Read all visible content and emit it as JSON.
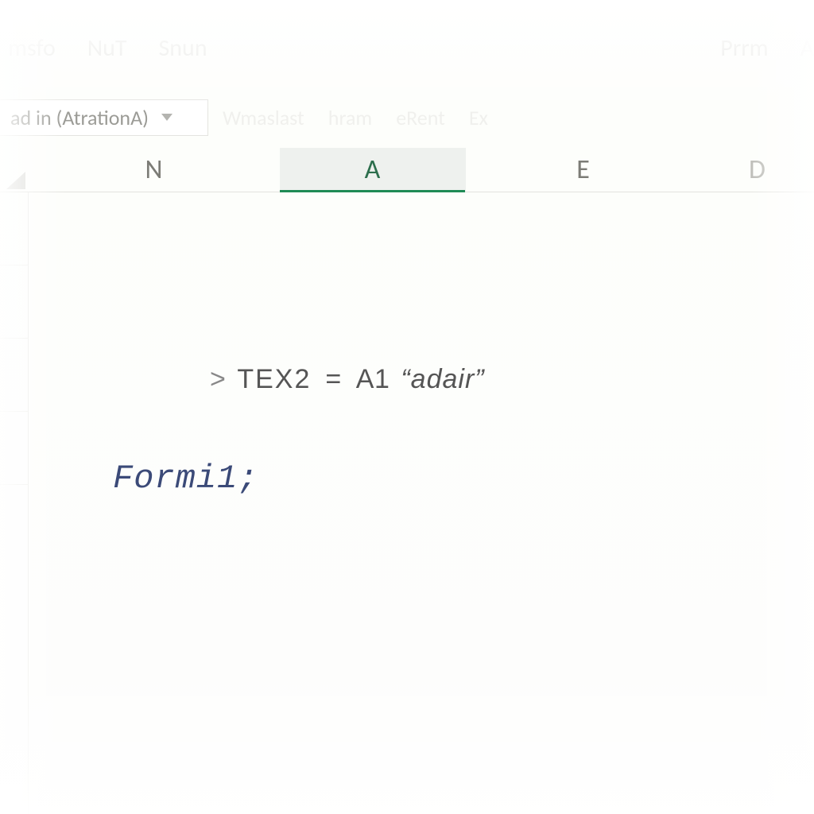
{
  "ribbon": {
    "items": [
      "msfo",
      "NuT",
      "Snun",
      "",
      "Prrm",
      "A"
    ]
  },
  "formula_bar": {
    "name_box_value": "ad in (AtrationA)",
    "hints": [
      "Wmaslast",
      "hram",
      "eRent",
      "Ex"
    ]
  },
  "columns": {
    "N": {
      "label": "N",
      "active": false
    },
    "A": {
      "label": "A",
      "active": true
    },
    "E": {
      "label": "E",
      "active": false
    },
    "D": {
      "label": "D",
      "active": false
    }
  },
  "rows": {
    "labels": [
      "",
      "",
      "",
      "",
      "",
      ""
    ]
  },
  "content": {
    "line1": {
      "prompt": ">",
      "lhs": "TEX2",
      "eq": "=",
      "rhs_cell": "A1",
      "rhs_string": "“adair”"
    },
    "line2": "Formi1;"
  }
}
